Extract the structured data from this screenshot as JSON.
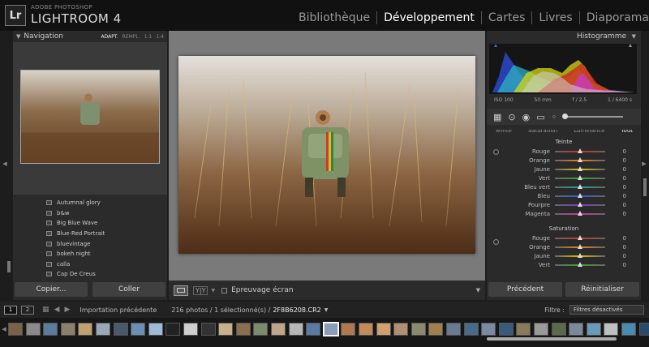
{
  "app": {
    "logo": "Lr",
    "brand_top": "ADOBE PHOTOSHOP",
    "brand_name": "LIGHTROOM 4"
  },
  "modules": [
    {
      "label": "Bibliothèque",
      "active": false
    },
    {
      "label": "Développement",
      "active": true
    },
    {
      "label": "Cartes",
      "active": false
    },
    {
      "label": "Livres",
      "active": false
    },
    {
      "label": "Diaporama",
      "active": false
    }
  ],
  "navigation": {
    "title": "Navigation",
    "zoom_options": [
      "ADAPT.",
      "REMPL.",
      "1:1",
      "1:4"
    ],
    "zoom_active": "ADAPT."
  },
  "presets": [
    "Autumnal glory",
    "b&w",
    "Big Blue Wave",
    "Blue-Red Portrait",
    "bluevintage",
    "bokeh night",
    "calla",
    "Cap De Creus"
  ],
  "left_buttons": {
    "copy": "Copier...",
    "paste": "Coller"
  },
  "toolbar": {
    "view_label": "Y|Y",
    "softproof": "Epreuvage écran"
  },
  "histogram": {
    "title": "Histogramme",
    "iso": "ISO 100",
    "focal": "50 mm",
    "aperture": "f / 2.5",
    "shutter": "1 / 6400 s"
  },
  "hsl": {
    "tabs": [
      "Teinte",
      "Saturation",
      "Luminance",
      "Tout"
    ],
    "active_tab": "Tout",
    "teinte_title": "Teinte",
    "saturation_title": "Saturation",
    "teinte_rows": [
      {
        "label": "Rouge",
        "value": "0",
        "color": "#c0392b"
      },
      {
        "label": "Orange",
        "value": "0",
        "color": "#e67e22"
      },
      {
        "label": "Jaune",
        "value": "0",
        "color": "#d4c21b"
      },
      {
        "label": "Vert",
        "value": "0",
        "color": "#3aa03a"
      },
      {
        "label": "Bleu vert",
        "value": "0",
        "color": "#1fa39a"
      },
      {
        "label": "Bleu",
        "value": "0",
        "color": "#2f5fd0"
      },
      {
        "label": "Pourpre",
        "value": "0",
        "color": "#7d3fc4"
      },
      {
        "label": "Magenta",
        "value": "0",
        "color": "#c23a9e"
      }
    ],
    "saturation_rows": [
      {
        "label": "Rouge",
        "value": "0",
        "color": "#c0392b"
      },
      {
        "label": "Orange",
        "value": "0",
        "color": "#e67e22"
      },
      {
        "label": "Jaune",
        "value": "0",
        "color": "#d4c21b"
      },
      {
        "label": "Vert",
        "value": "0",
        "color": "#3aa03a"
      }
    ]
  },
  "right_buttons": {
    "previous": "Précédent",
    "reset": "Réinitialiser"
  },
  "filmbar": {
    "screen1": "1",
    "screen2": "2",
    "source": "Importation précédente",
    "count": "216 photos / 1 sélectionné(s) /",
    "filename": "2F8B6208.CR2",
    "filter_label": "Filtre :",
    "filter_value": "Filtres désactivés"
  },
  "filmstrip": {
    "thumb_colors": [
      "#7a6248",
      "#8a8a8a",
      "#5d7b9c",
      "#8b7f6e",
      "#c0a070",
      "#9aa9b8",
      "#4a5a6c",
      "#6b8fb5",
      "#9fb9d8",
      "#222",
      "#cfcfcf",
      "#333",
      "#c8b08a",
      "#8a6e4e",
      "#7d8a6c",
      "#c0a58a",
      "#b7b7b7",
      "#5b7aa3",
      "#8a9cb6",
      "#b07850",
      "#c48a5a",
      "#d0a070",
      "#b09070",
      "#8a8a70",
      "#a08050",
      "#6a7a90",
      "#4a6a8a",
      "#7a8aa0",
      "#3a5a7a",
      "#8a7a5a",
      "#9a9a9a",
      "#5a6a4a",
      "#7a8a9a",
      "#6a9ab8",
      "#c0c0c0",
      "#4a8ab0",
      "#2a4a6a"
    ],
    "selected_index": 18
  }
}
